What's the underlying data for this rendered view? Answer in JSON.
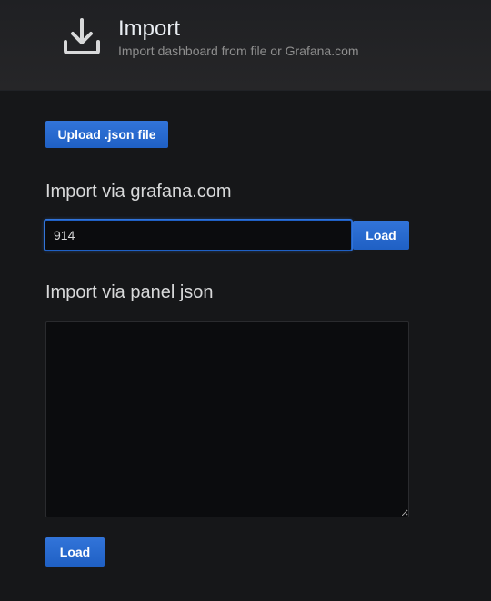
{
  "header": {
    "title": "Import",
    "subtitle": "Import dashboard from file or Grafana.com",
    "icon": "download-icon"
  },
  "upload": {
    "label": "Upload .json file"
  },
  "grafana_com": {
    "heading": "Import via grafana.com",
    "input_value": "914",
    "load_label": "Load"
  },
  "panel_json": {
    "heading": "Import via panel json",
    "textarea_value": "",
    "load_label": "Load"
  },
  "colors": {
    "background": "#161719",
    "header_background": "#262628",
    "primary_button": "#3274d9",
    "input_background": "#0b0c0e",
    "focus_border": "#1f60c4"
  }
}
